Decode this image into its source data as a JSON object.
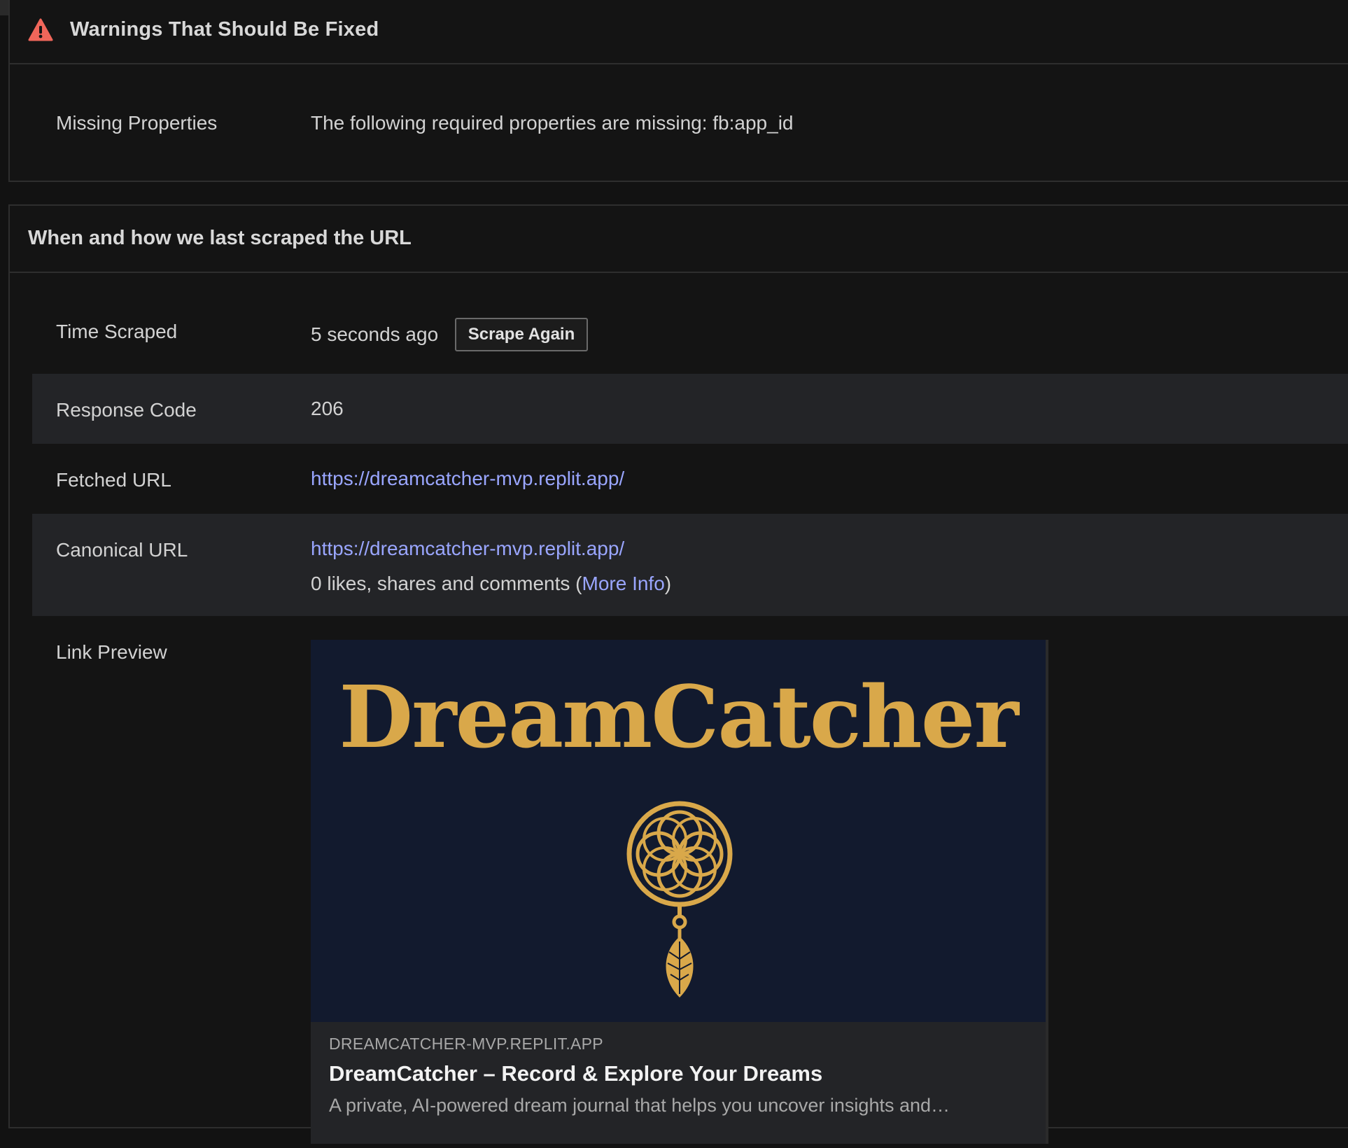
{
  "warnings": {
    "title": "Warnings That Should Be Fixed",
    "icon": "warning-triangle-icon",
    "rows": [
      {
        "label": "Missing Properties",
        "value": "The following required properties are missing: fb:app_id"
      }
    ]
  },
  "scrape": {
    "title": "When and how we last scraped the URL",
    "time_scraped": {
      "label": "Time Scraped",
      "value": "5 seconds ago",
      "button": "Scrape Again"
    },
    "response_code": {
      "label": "Response Code",
      "value": "206"
    },
    "fetched_url": {
      "label": "Fetched URL",
      "value": "https://dreamcatcher-mvp.replit.app/"
    },
    "canonical_url": {
      "label": "Canonical URL",
      "value": "https://dreamcatcher-mvp.replit.app/",
      "engagement_prefix": "0 likes, shares and comments (",
      "more_info": "More Info",
      "engagement_suffix": ")"
    },
    "link_preview": {
      "label": "Link Preview",
      "image_wordmark": "DreamCatcher",
      "domain": "DREAMCATCHER-MVP.REPLIT.APP",
      "title": "DreamCatcher – Record & Explore Your Dreams",
      "description": "A private, AI-powered dream journal that helps you uncover insights and…"
    }
  },
  "colors": {
    "background": "#121212",
    "alt_row": "#232427",
    "link": "#9aa6ff",
    "warning": "#f0665a",
    "brand_gold": "#d9a84a",
    "brand_navy": "#121a2e"
  }
}
